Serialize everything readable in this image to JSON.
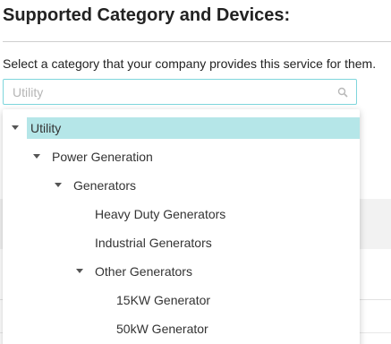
{
  "section": {
    "title": "Supported Category and Devices:",
    "instruction": "Select a category that your company provides this service for them."
  },
  "search": {
    "placeholder": "Utility",
    "value": "",
    "icon": "search-icon"
  },
  "tree": {
    "selected": "Utility",
    "nodes": [
      {
        "label": "Utility",
        "level": 0,
        "expanded": true,
        "selected": true
      },
      {
        "label": "Power Generation",
        "level": 1,
        "expanded": true
      },
      {
        "label": "Generators",
        "level": 2,
        "expanded": true
      },
      {
        "label": "Heavy Duty Generators",
        "level": 3,
        "leaf": true
      },
      {
        "label": "Industrial Generators",
        "level": 3,
        "leaf": true
      },
      {
        "label": "Other Generators",
        "level": 3,
        "expanded": true
      },
      {
        "label": "15KW Generator",
        "level": 4,
        "leaf": true
      },
      {
        "label": "50kW Generator",
        "level": 4,
        "leaf": true
      }
    ]
  },
  "colors": {
    "selected_bg": "#b5e6e8",
    "focus_border": "#7fd6dc"
  }
}
